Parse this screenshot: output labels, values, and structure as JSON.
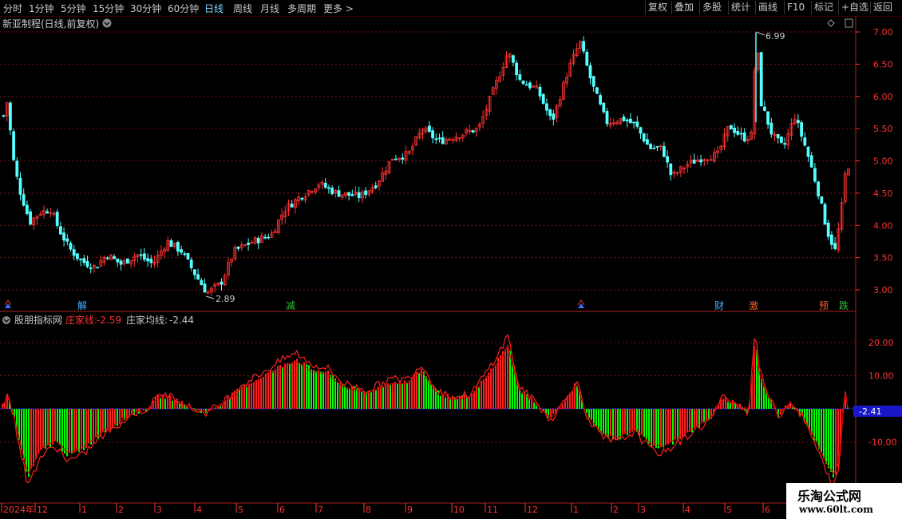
{
  "toolbar": {
    "timeframes": [
      "分时",
      "1分钟",
      "5分钟",
      "15分钟",
      "30分钟",
      "60分钟",
      "日线",
      "周线",
      "月线",
      "多周期",
      "更多 >"
    ],
    "active_timeframe": "日线",
    "right_buttons": [
      "复权",
      "叠加",
      "多股",
      "统计",
      "画线",
      "F10",
      "标记",
      "+自选",
      "返回"
    ]
  },
  "main_chart": {
    "title": "新亚制程(日线,前复权)",
    "price_axis": [
      "7.00",
      "6.50",
      "6.00",
      "5.50",
      "5.00",
      "4.50",
      "4.00",
      "3.50",
      "3.00"
    ],
    "high_label": "6.99",
    "low_label": "2.89",
    "event_markers": [
      "解",
      "减",
      "财",
      "激",
      "预",
      "跌"
    ]
  },
  "indicator": {
    "name": "股朋指标网",
    "line1_label": "庄家线:",
    "line1_value": "-2.59",
    "line2_label": "庄家均线:",
    "line2_value": "-2.44",
    "axis": [
      "20.00",
      "10.00",
      "-10.00"
    ],
    "current_value": "-2.41"
  },
  "date_axis": [
    "2024年",
    "12",
    "1",
    "2",
    "3",
    "4",
    "5",
    "6",
    "7",
    "8",
    "9",
    "10",
    "11",
    "12",
    "1",
    "2",
    "3",
    "4",
    "5",
    "6"
  ],
  "watermark": {
    "line1": "乐淘公式网",
    "line2": "www.60lt.com"
  },
  "colors": {
    "up": "#ff3232",
    "down": "#54ffff",
    "bar_up": "#ff2020",
    "bar_down": "#00ff00",
    "axis": "#ff3232",
    "grid": "#7a1010"
  }
}
